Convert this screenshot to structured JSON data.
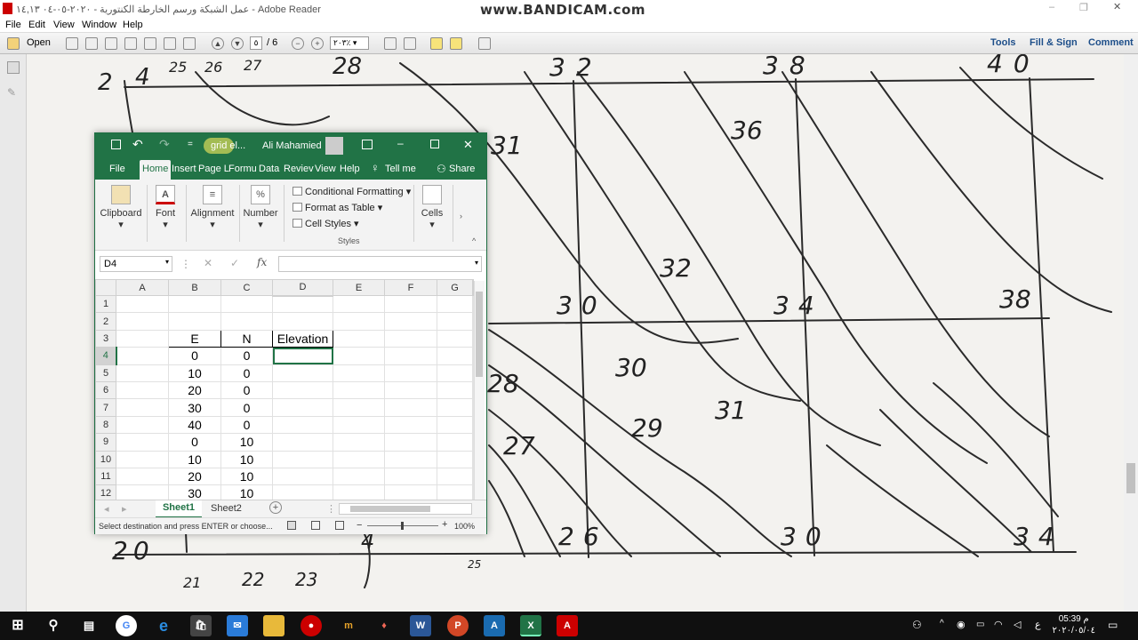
{
  "reader": {
    "title": "عمل الشبكة ورسم الخارطة الكنتورية - ٢٠٢٠-٠٥-٠٤ ١٤,١٣ - Adobe Reader",
    "watermark": "www.BANDICAM.com",
    "menu": [
      "File",
      "Edit",
      "View",
      "Window",
      "Help"
    ],
    "open_label": "Open",
    "page_current": "٥",
    "page_total": "/ 6",
    "zoom": "٢٠٣٪",
    "tools_label": "Tools",
    "fillsign_label": "Fill & Sign",
    "comment_label": "Comment"
  },
  "drawing": {
    "numbers": [
      "2",
      "4",
      "25",
      "26",
      "27",
      "28",
      "32",
      "38",
      "40",
      "31",
      "36",
      "32",
      "30",
      "34",
      "38",
      "30",
      "28",
      "31",
      "29",
      "27",
      "26",
      "30",
      "34",
      "20",
      "4",
      "25",
      "21",
      "22",
      "23"
    ]
  },
  "excel": {
    "filename": "grid el...",
    "user": "Ali Mahamied",
    "tabs": [
      "File",
      "Home",
      "Insert",
      "Page L",
      "Formu",
      "Data",
      "Reviev",
      "View",
      "Help"
    ],
    "tellme": "Tell me",
    "share": "Share",
    "ribbon": {
      "clipboard": "Clipboard",
      "font": "Font",
      "alignment": "Alignment",
      "number": "Number",
      "number_glyph": "%",
      "conditional": "Conditional Formatting",
      "format_table": "Format as Table",
      "cell_styles": "Cell Styles",
      "styles": "Styles",
      "cells": "Cells"
    },
    "namebox": "D4",
    "columns": [
      "A",
      "B",
      "C",
      "D",
      "E",
      "F",
      "G"
    ],
    "rows": [
      {
        "n": "1",
        "B": "",
        "C": "",
        "D": ""
      },
      {
        "n": "2",
        "B": "",
        "C": "",
        "D": ""
      },
      {
        "n": "3",
        "B": "E",
        "C": "N",
        "D": "Elevation"
      },
      {
        "n": "4",
        "B": "0",
        "C": "0",
        "D": ""
      },
      {
        "n": "5",
        "B": "10",
        "C": "0",
        "D": ""
      },
      {
        "n": "6",
        "B": "20",
        "C": "0",
        "D": ""
      },
      {
        "n": "7",
        "B": "30",
        "C": "0",
        "D": ""
      },
      {
        "n": "8",
        "B": "40",
        "C": "0",
        "D": ""
      },
      {
        "n": "9",
        "B": "0",
        "C": "10",
        "D": ""
      },
      {
        "n": "10",
        "B": "10",
        "C": "10",
        "D": ""
      },
      {
        "n": "11",
        "B": "20",
        "C": "10",
        "D": ""
      },
      {
        "n": "12",
        "B": "30",
        "C": "10",
        "D": ""
      }
    ],
    "sheets": [
      "Sheet1",
      "Sheet2"
    ],
    "status": "Select destination and press ENTER or choose...",
    "zoom": "100%"
  },
  "taskbar": {
    "lang": "ع",
    "time": "05:39 م",
    "date": "٢٠٢٠/٠٥/٠٤"
  }
}
